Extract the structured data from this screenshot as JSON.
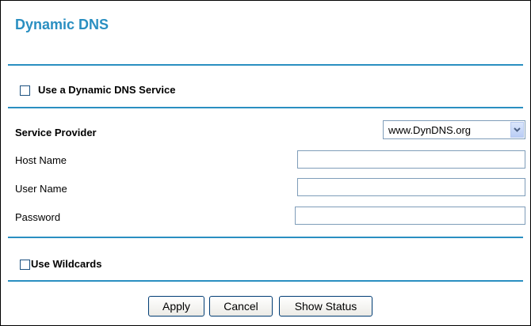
{
  "page": {
    "title": "Dynamic DNS"
  },
  "ddns": {
    "use_service_label": "Use a Dynamic DNS Service",
    "use_service_checked": false
  },
  "form": {
    "provider_label": "Service Provider",
    "provider_value": "www.DynDNS.org",
    "host_label": "Host Name",
    "host_value": "",
    "user_label": "User Name",
    "user_value": "",
    "password_label": "Password",
    "password_value": ""
  },
  "wildcards": {
    "label": "Use Wildcards",
    "checked": false
  },
  "buttons": {
    "apply": "Apply",
    "cancel": "Cancel",
    "show_status": "Show Status"
  },
  "colors": {
    "accent": "#2a8fc1",
    "border": "#000000",
    "field_border": "#7f9db9"
  },
  "icons": {
    "dropdown": "chevron-down-icon"
  }
}
